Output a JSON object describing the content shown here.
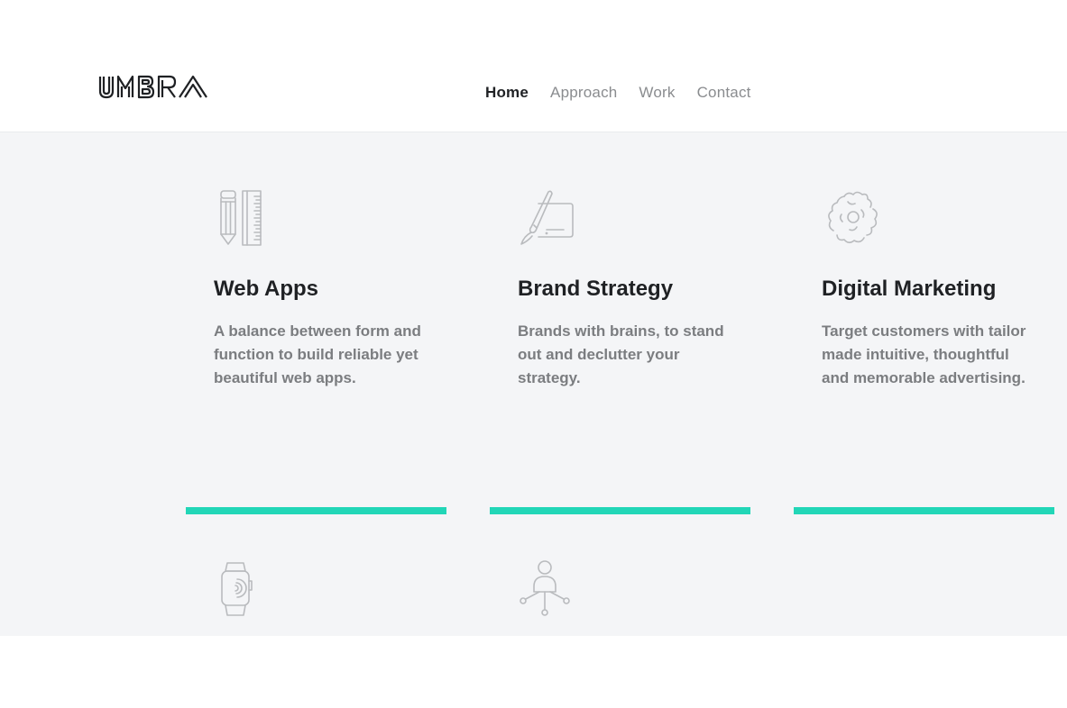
{
  "brand": {
    "logo_text": "UMBRA"
  },
  "nav": {
    "items": [
      {
        "label": "Home",
        "active": true
      },
      {
        "label": "Approach",
        "active": false
      },
      {
        "label": "Work",
        "active": false
      },
      {
        "label": "Contact",
        "active": false
      }
    ]
  },
  "services": [
    {
      "title": "Web Apps",
      "description": "A balance between form and function to build reliable yet beautiful web apps.",
      "icon": "pencil-ruler-icon"
    },
    {
      "title": "Brand Strategy",
      "description": "Brands with brains, to stand out and declutter your strategy.",
      "icon": "brush-tablet-icon"
    },
    {
      "title": "Digital Marketing",
      "description": "Target customers with tailor made intuitive, thoughtful and memorable advertising.",
      "icon": "puzzle-icon"
    },
    {
      "icon": "smartwatch-icon"
    },
    {
      "icon": "network-user-icon"
    }
  ],
  "colors": {
    "accent": "#22d6b7",
    "section_bg": "#f4f5f7",
    "heading": "#1f2124",
    "body_text": "#7b7d80",
    "icon_stroke": "#b9bbbe"
  }
}
